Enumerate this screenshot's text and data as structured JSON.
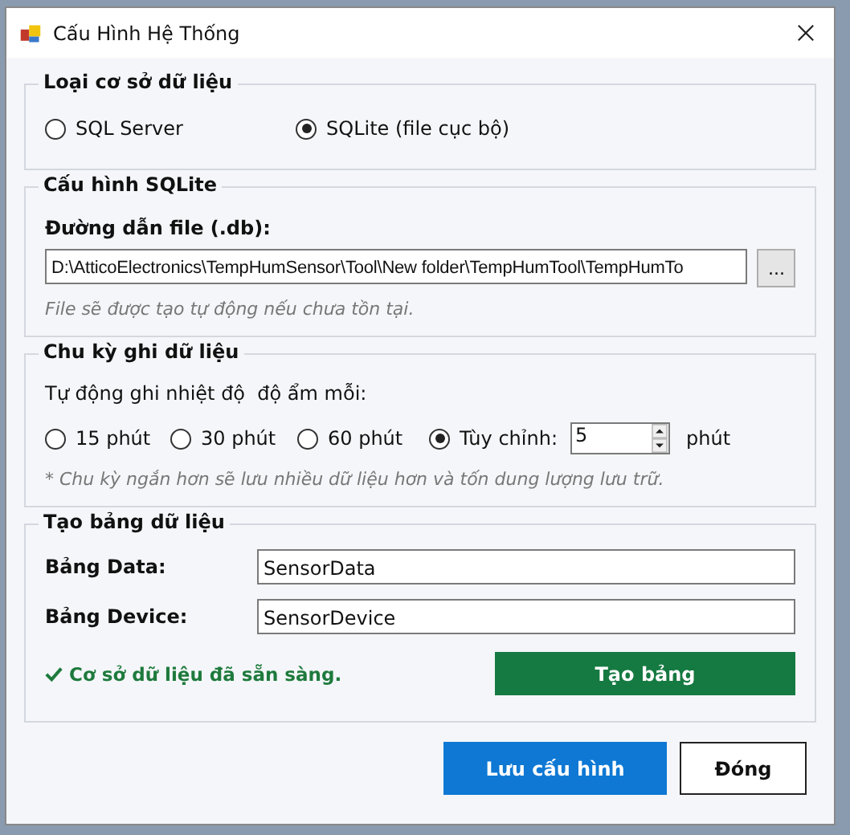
{
  "window": {
    "title": "Cấu Hình Hệ Thống"
  },
  "database_type": {
    "title": "Loại cơ sở dữ liệu",
    "options": [
      {
        "label": "SQL Server",
        "selected": false
      },
      {
        "label": "SQLite (file cục bộ)",
        "selected": true
      }
    ]
  },
  "sqlite_config": {
    "title": "Cấu hình SQLite",
    "path_label": "Đường dẫn file (.db):",
    "path_value": "D:\\AtticoElectronics\\TempHumSensor\\Tool\\New folder\\TempHumTool\\TempHumTo",
    "browse_button": "...",
    "hint": "File sẽ được tạo tự động nếu chưa tồn tại."
  },
  "log_interval": {
    "title": "Chu kỳ ghi dữ liệu",
    "prompt": "Tự động ghi nhiệt độ  độ ẩm mỗi:",
    "options": [
      {
        "label": "15 phút",
        "selected": false
      },
      {
        "label": "30 phút",
        "selected": false
      },
      {
        "label": "60 phút",
        "selected": false
      },
      {
        "label": "Tùy chỉnh:",
        "selected": true
      }
    ],
    "custom_value": "5",
    "unit": "phút",
    "note": "* Chu kỳ ngắn hơn sẽ lưu nhiều dữ liệu hơn và tốn dung lượng lưu trữ."
  },
  "tables": {
    "title": "Tạo bảng dữ liệu",
    "fields": [
      {
        "label": "Bảng Data:",
        "value": "SensorData"
      },
      {
        "label": "Bảng Device:",
        "value": "SensorDevice"
      }
    ],
    "status": "Cơ sở dữ liệu đã sẵn sàng.",
    "create_button": "Tạo bảng"
  },
  "buttons": [
    {
      "label": "Lưu cấu hình",
      "kind": "primary"
    },
    {
      "label": "Đóng",
      "kind": "secondary"
    }
  ]
}
